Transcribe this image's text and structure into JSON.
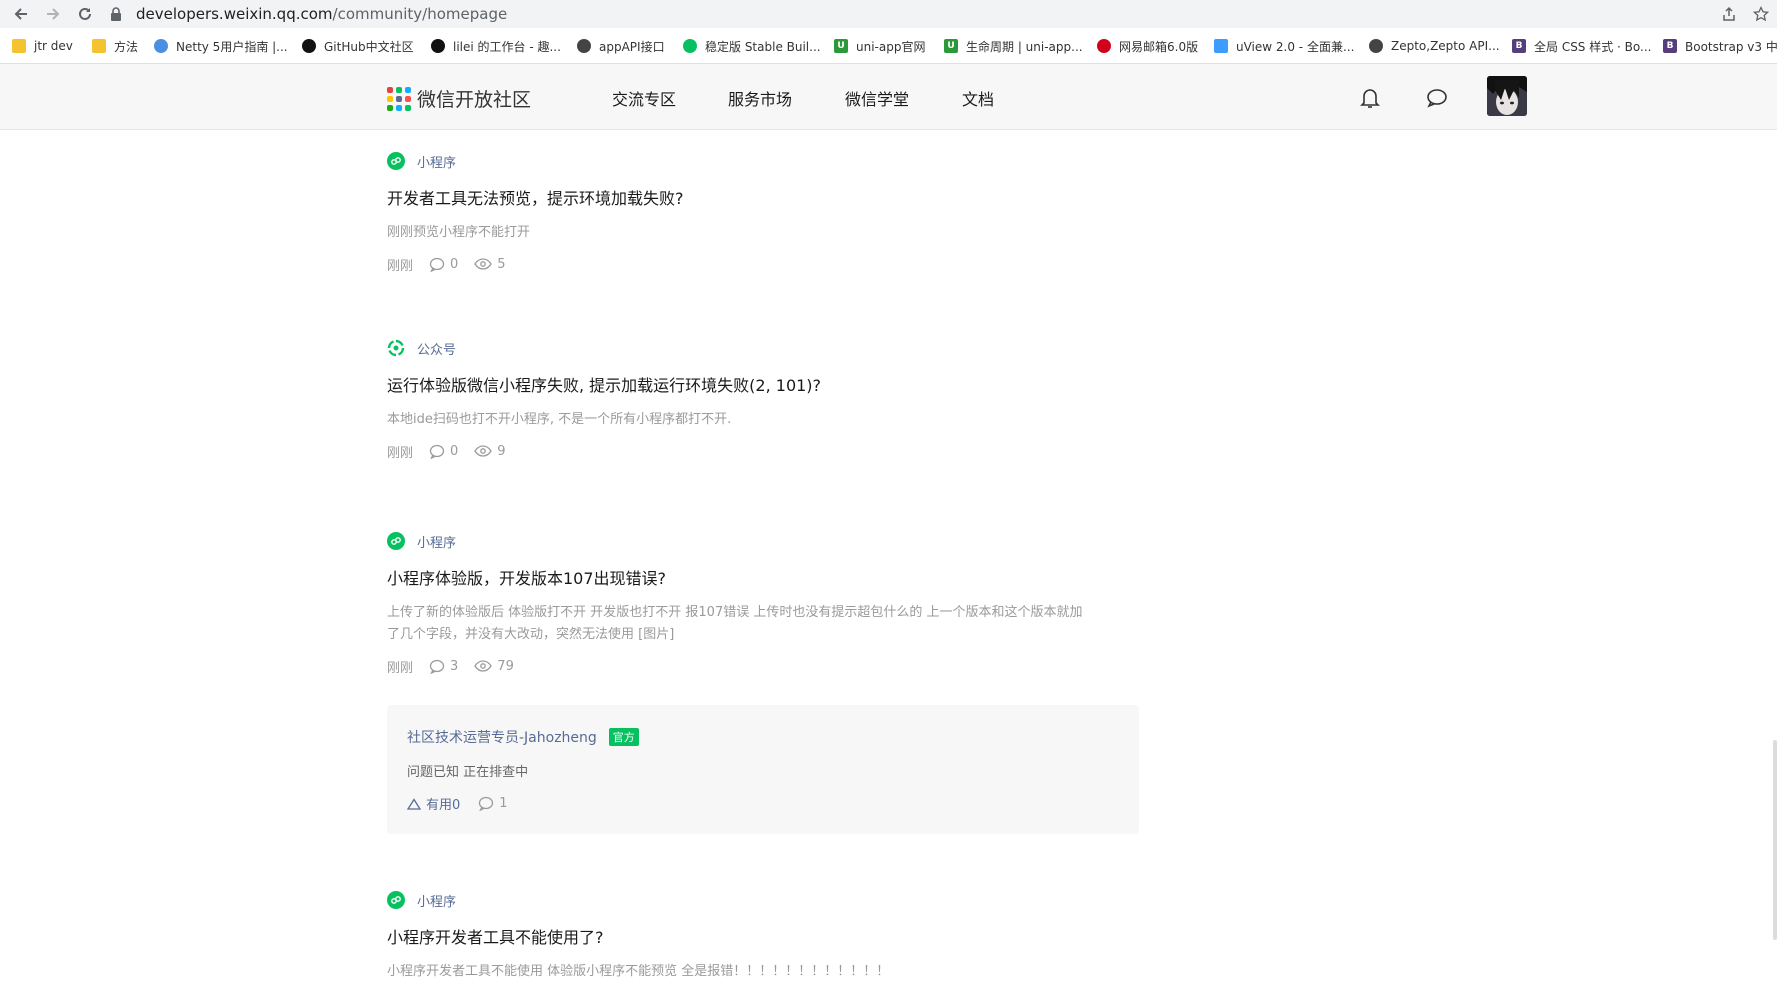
{
  "browser": {
    "url_host": "developers.weixin.qq.com",
    "url_path": "/community/homepage",
    "bookmarks": [
      {
        "label": "jtr dev",
        "icon": "folder-icon",
        "color": "#f4c430"
      },
      {
        "label": "方法",
        "icon": "folder-icon",
        "color": "#f4c430"
      },
      {
        "label": "Netty 5用户指南 |...",
        "icon": "globe-icon",
        "color": "#4a90e2"
      },
      {
        "label": "GitHub中文社区",
        "icon": "github-icon",
        "color": "#111111"
      },
      {
        "label": "lilei 的工作台 - 趣...",
        "icon": "site-icon",
        "color": "#111111"
      },
      {
        "label": "appAPI接口",
        "icon": "globe-icon",
        "color": "#333333"
      },
      {
        "label": "稳定版 Stable Buil...",
        "icon": "wechat-icon",
        "color": "#07c160"
      },
      {
        "label": "uni-app官网",
        "icon": "uniapp-icon",
        "color": "#2b9939"
      },
      {
        "label": "生命周期 | uni-app...",
        "icon": "uniapp-icon",
        "color": "#2b9939"
      },
      {
        "label": "网易邮箱6.0版",
        "icon": "netease-icon",
        "color": "#d0021b"
      },
      {
        "label": "uView 2.0 - 全面兼...",
        "icon": "uview-icon",
        "color": "#3c9cff"
      },
      {
        "label": "Zepto,Zepto API...",
        "icon": "globe-icon",
        "color": "#333333"
      },
      {
        "label": "全局 CSS 样式 · Bo...",
        "icon": "bootstrap-icon",
        "color": "#563d7c"
      },
      {
        "label": "Bootstrap v3 中",
        "icon": "bootstrap-icon",
        "color": "#563d7c"
      }
    ]
  },
  "header": {
    "logo_text": "微信开放社区",
    "nav": [
      "交流专区",
      "服务市场",
      "微信学堂",
      "文档"
    ],
    "logo_colors": [
      "#e64340",
      "#07c160",
      "#1aad19",
      "#10aeff",
      "#ffc300",
      "#576b95",
      "#fa5151",
      "#07c160",
      "#10aeff"
    ]
  },
  "posts": [
    {
      "category": "小程序",
      "category_icon": "miniprogram-icon",
      "title": "开发者工具无法预览，提示环境加载失败?",
      "excerpt": "刚刚预览小程序不能打开",
      "time": "刚刚",
      "comments": "0",
      "views": "5"
    },
    {
      "category": "公众号",
      "category_icon": "official-account-icon",
      "title": "运行体验版微信小程序失败, 提示加载运行环境失败(2, 101)?",
      "excerpt": "本地ide扫码也打不开小程序, 不是一个所有小程序都打不开.",
      "time": "刚刚",
      "comments": "0",
      "views": "9"
    },
    {
      "category": "小程序",
      "category_icon": "miniprogram-icon",
      "title": "小程序体验版，开发版本107出现错误?",
      "excerpt_line1": "上传了新的体验版后 体验版打不开 开发版也打不开 报107错误 上传时也没有提示超包什么的 上一个版本和这个版本就加",
      "excerpt_line2": "了几个字段，并没有大改动，突然无法使用 [图片]",
      "time": "刚刚",
      "comments": "3",
      "views": "79"
    },
    {
      "category": "小程序",
      "category_icon": "miniprogram-icon",
      "title": "小程序开发者工具不能使用了?",
      "excerpt": "小程序开发者工具不能使用 体验版小程序不能预览 全是报错！！！！！！！！！！！！"
    }
  ],
  "reply": {
    "author": "社区技术运营专员-Jahozheng",
    "badge": "官方",
    "text": "问题已知 正在排查中",
    "useful": "有用0",
    "comments": "1"
  }
}
